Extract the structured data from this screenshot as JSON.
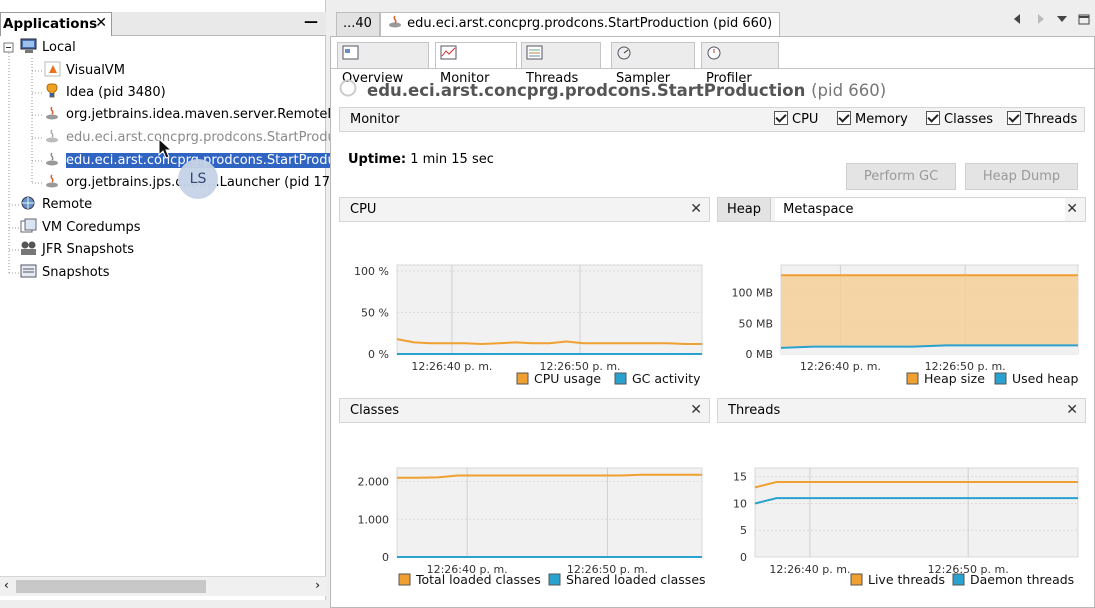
{
  "applications": {
    "tab_label": "Applications",
    "close_glyph": "✕",
    "minimize_glyph": "—",
    "tree": [
      {
        "label": "Local",
        "icon": "computer-icon"
      },
      {
        "label": "VisualVM",
        "icon": "visualvm-icon"
      },
      {
        "label": "Idea (pid 3480)",
        "icon": "idea-icon"
      },
      {
        "label": "org.jetbrains.idea.maven.server.RemoteM",
        "icon": "java-icon"
      },
      {
        "label": "edu.eci.arst.concprg.prodcons.StartProdu",
        "icon": "java-icon"
      },
      {
        "label": "edu.eci.arst.concprg.prodcons.StartProdu",
        "icon": "java-icon"
      },
      {
        "label": "org.jetbrains.jps.c.........Launcher (pid 17",
        "icon": "java-icon"
      },
      {
        "label": "Remote",
        "icon": "remote-icon"
      },
      {
        "label": "VM Coredumps",
        "icon": "coredump-icon"
      },
      {
        "label": "JFR Snapshots",
        "icon": "jfr-icon"
      },
      {
        "label": "Snapshots",
        "icon": "snapshot-icon"
      }
    ],
    "overlay_badge": "LS"
  },
  "doc_tabs": {
    "prev_tab": "...40",
    "active_tab": "edu.eci.arst.concprg.prodcons.StartProduction (pid 660)",
    "close_glyph": "✕"
  },
  "sub_tabs": [
    "Overview",
    "Monitor",
    "Threads",
    "Sampler",
    "Profiler"
  ],
  "title": {
    "main": "edu.eci.arst.concprg.prodcons.StartProduction",
    "pid": "(pid 660)"
  },
  "monitor_bar": {
    "label": "Monitor",
    "checks": [
      "CPU",
      "Memory",
      "Classes",
      "Threads"
    ]
  },
  "uptime": {
    "label": "Uptime:",
    "value": "1 min 15 sec"
  },
  "buttons": {
    "gc": "Perform GC",
    "heap": "Heap Dump"
  },
  "panels": {
    "cpu": {
      "title": "CPU",
      "close": "✕"
    },
    "heap": {
      "tab1": "Heap",
      "tab2": "Metaspace",
      "close": "✕"
    },
    "classes": {
      "title": "Classes",
      "close": "✕"
    },
    "threads": {
      "title": "Threads",
      "close": "✕"
    }
  },
  "colors": {
    "orange": "#f0a030",
    "blue": "#2aa2cf",
    "selection": "#2f64c2"
  },
  "chart_data": [
    {
      "type": "line",
      "title": "CPU",
      "yticks": [
        "100 %",
        "50 %",
        "0 %"
      ],
      "ylim": [
        0,
        100
      ],
      "xticks": [
        "12:26:40 p. m.",
        "12:26:50 p. m."
      ],
      "series": [
        {
          "name": "CPU usage",
          "color": "#f0a030",
          "values": [
            18,
            14,
            13,
            13,
            13,
            12,
            13,
            14,
            13,
            13,
            15,
            13,
            13,
            13,
            13,
            13,
            13,
            12,
            12
          ]
        },
        {
          "name": "GC activity",
          "color": "#2aa2cf",
          "values": [
            0,
            0,
            0,
            0,
            0,
            0,
            0,
            0,
            0,
            0,
            0,
            0,
            0,
            0,
            0,
            0,
            0,
            0,
            0
          ]
        }
      ]
    },
    {
      "type": "area",
      "title": "Heap",
      "yticks": [
        "100 MB",
        "50 MB",
        "0 MB"
      ],
      "ylim": [
        0,
        100
      ],
      "xticks": [
        "12:26:40 p. m.",
        "12:26:50 p. m."
      ],
      "series": [
        {
          "name": "Heap size",
          "color": "#f0a030",
          "values": [
            128,
            128,
            128,
            128,
            128,
            128,
            128,
            128,
            128,
            128,
            128,
            128,
            128,
            128,
            128,
            128,
            128,
            128,
            128
          ]
        },
        {
          "name": "Used heap",
          "color": "#2aa2cf",
          "values": [
            10,
            11,
            12,
            12,
            12,
            12,
            12,
            12,
            12,
            13,
            14,
            14,
            14,
            14,
            14,
            14,
            14,
            14,
            14
          ]
        }
      ]
    },
    {
      "type": "line",
      "title": "Classes",
      "yticks": [
        "2.000",
        "1.000",
        "0"
      ],
      "ylim": [
        0,
        2000
      ],
      "xticks": [
        "12:26:40 p. m.",
        "12:26:50 p. m."
      ],
      "series": [
        {
          "name": "Total loaded classes",
          "color": "#f0a030",
          "values": [
            2100,
            2100,
            2110,
            2160,
            2160,
            2160,
            2160,
            2160,
            2160,
            2160,
            2160,
            2160,
            2180,
            2180,
            2180,
            2180
          ]
        },
        {
          "name": "Shared loaded classes",
          "color": "#2aa2cf",
          "values": [
            0,
            0,
            0,
            0,
            0,
            0,
            0,
            0,
            0,
            0,
            0,
            0,
            0,
            0,
            0,
            0
          ]
        }
      ]
    },
    {
      "type": "line",
      "title": "Threads",
      "yticks": [
        "15",
        "10",
        "5",
        "0"
      ],
      "ylim": [
        0,
        15
      ],
      "xticks": [
        "12:26:40 p. m.",
        "12:26:50 p. m."
      ],
      "series": [
        {
          "name": "Live threads",
          "color": "#f0a030",
          "values": [
            13,
            14,
            14,
            14,
            14,
            14,
            14,
            14,
            14,
            14,
            14,
            14,
            14,
            14,
            14,
            14
          ]
        },
        {
          "name": "Daemon threads",
          "color": "#2aa2cf",
          "values": [
            10,
            11,
            11,
            11,
            11,
            11,
            11,
            11,
            11,
            11,
            11,
            11,
            11,
            11,
            11,
            11
          ]
        }
      ]
    }
  ]
}
